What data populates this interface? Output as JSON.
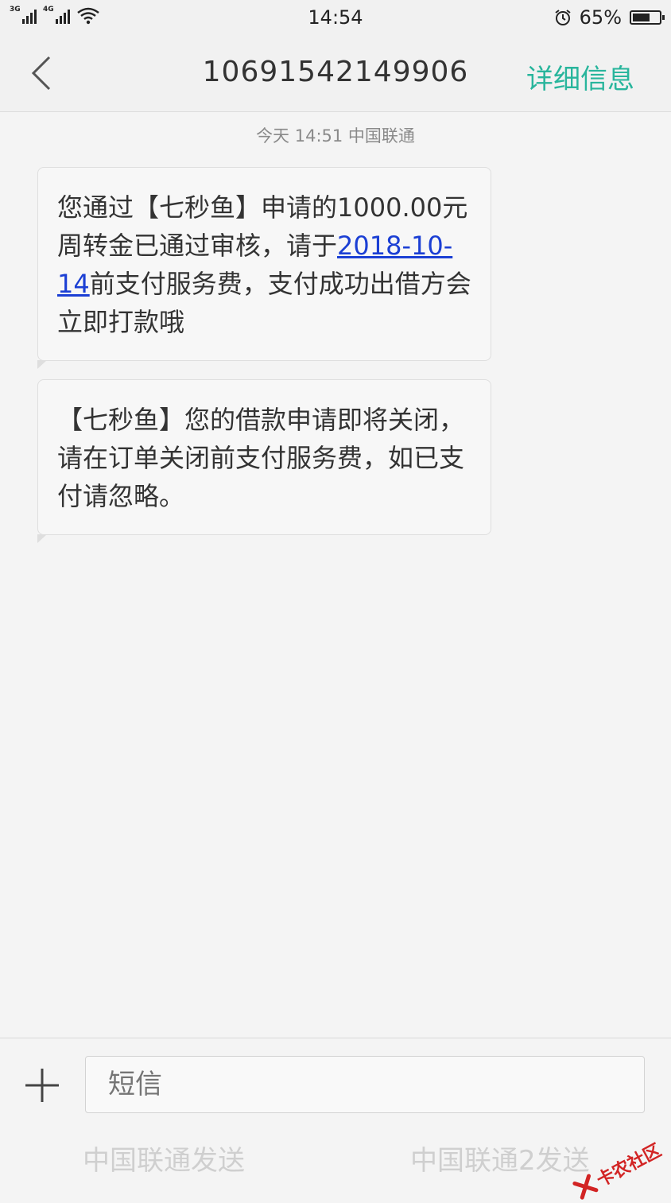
{
  "status_bar": {
    "sim1_label": "3G",
    "sim2_label": "4G",
    "time": "14:54",
    "battery_text": "65%",
    "battery_level": 0.65
  },
  "header": {
    "title": "10691542149906",
    "details_label": "详细信息",
    "accent_color": "#28b59c"
  },
  "conversation": {
    "date_label": "今天  14:51  中国联通",
    "messages": [
      {
        "before_link": "您通过【七秒鱼】申请的1000.00元周转金已通过审核，请于",
        "link": "2018-10-14",
        "after_link": "前支付服务费，支付成功出借方会立即打款哦"
      },
      {
        "text": "【七秒鱼】您的借款申请即将关闭，请在订单关闭前支付服务费，如已支付请忽略。"
      }
    ]
  },
  "composer": {
    "placeholder": "短信",
    "send_sim1": "中国联通发送",
    "send_sim2": "中国联通2发送"
  },
  "watermark": {
    "text": "卡农社区",
    "color": "#d22424"
  }
}
